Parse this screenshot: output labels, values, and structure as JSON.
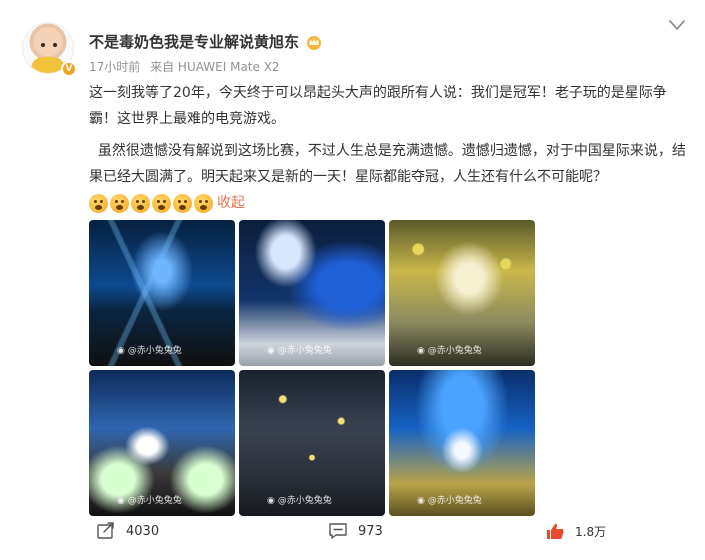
{
  "post": {
    "author": "不是毒奶色我是专业解说黄旭东",
    "time": "17小时前",
    "source": "来自 HUAWEI Mate X2",
    "verify_badge": "V",
    "paragraph_1": "这一刻我等了20年，今天终于可以昂起头大声的跟所有人说：我们是冠军！老子玩的是星际争霸！这世界上最难的电竞游戏。",
    "paragraph_2": "虽然很遗憾没有解说到这场比赛，不过人生总是充满遗憾。遗憾归遗憾，对于中国星际来说，结果已经大圆满了。明天起来又是新的一天！星际都能夺冠，人生还有什么不可能呢？",
    "emoji_count": 6,
    "emoji_name": "cry-laugh-emoji",
    "collapse_label": "收起"
  },
  "images": [
    {
      "name": "stage-blue-lights-photo",
      "watermark": "@赤小兔兔兔"
    },
    {
      "name": "trophy-stage-photo",
      "watermark": "@赤小兔兔兔"
    },
    {
      "name": "winner-trophy-confetti-photo",
      "watermark": "@赤小兔兔兔"
    },
    {
      "name": "arena-screen-fireworks-photo",
      "watermark": "@赤小兔兔兔"
    },
    {
      "name": "audience-confetti-photo",
      "watermark": "@赤小兔兔兔"
    },
    {
      "name": "champion-on-stage-photo",
      "watermark": "@赤小兔兔兔"
    }
  ],
  "actions": {
    "repost_count": "4030",
    "comment_count": "973",
    "like_count": "1.8万"
  },
  "colors": {
    "accent": "#eb7350",
    "meta": "#939393",
    "badge": "#f5a11b",
    "like": "#e8492d"
  }
}
